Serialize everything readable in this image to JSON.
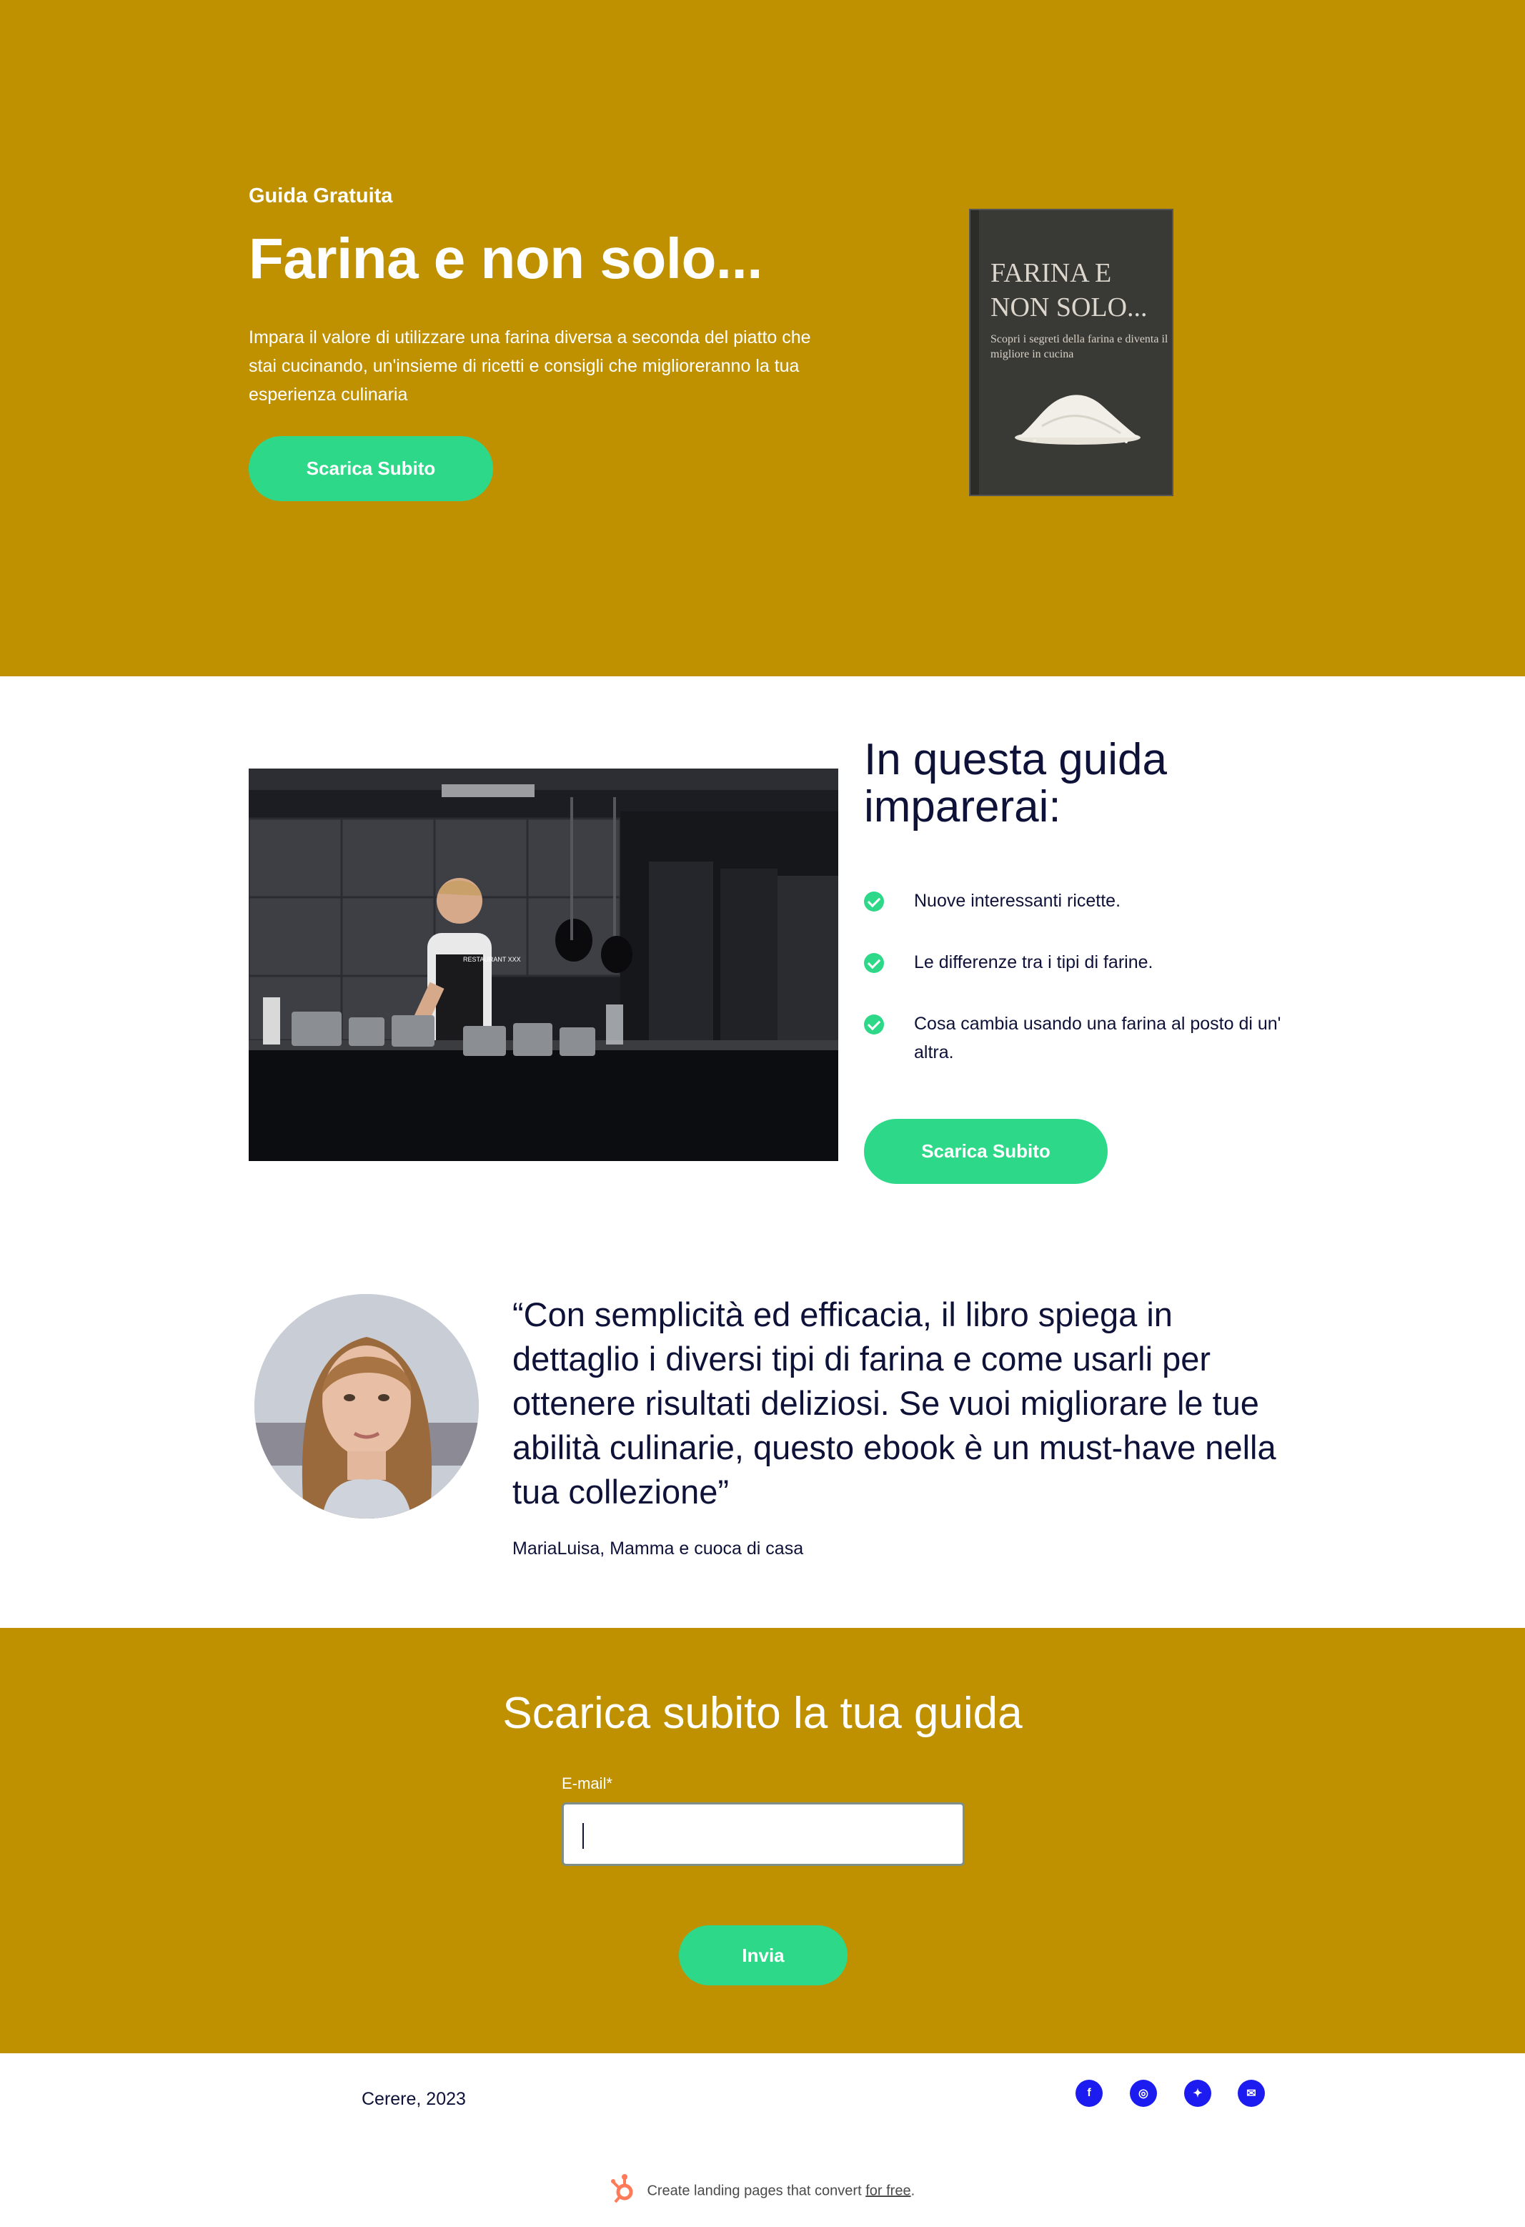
{
  "hero": {
    "eyebrow": "Guida Gratuita",
    "title": "Farina e non solo...",
    "description": "Impara il valore di utilizzare una farina diversa a seconda del piatto che stai cucinando, un'insieme di ricetti e consigli che miglioreranno la tua esperienza culinaria",
    "cta_label": "Scarica Subito",
    "background_color": "#bf9100",
    "book": {
      "title": "FARINA E NON SOLO...",
      "subtitle": "Scopri i segreti della farina e diventa il migliore in cucina"
    }
  },
  "guide": {
    "title": "In questa guida imparerai:",
    "items": [
      {
        "text": "Nuove interessanti ricette."
      },
      {
        "text": "Le differenze tra i tipi di farine."
      },
      {
        "text": "Cosa cambia usando una farina al posto di un' altra."
      }
    ],
    "cta_label": "Scarica Subito",
    "kitchen_sign": "RESTAURANT XXX"
  },
  "testimonial": {
    "quote": "“Con semplicità ed efficacia, il libro spiega in dettaglio i diversi tipi di farina e come usarli per ottenere risultati deliziosi. Se vuoi migliorare le tue abilità culinarie, questo ebook è un must-have nella tua collezione”",
    "author": "MariaLuisa, Mamma e cuoca di casa"
  },
  "form": {
    "title": "Scarica subito la tua guida",
    "email_label": "E-mail*",
    "email_value": "",
    "submit_label": "Invia"
  },
  "footer": {
    "copyright": "Cerere, 2023",
    "social": [
      {
        "icon": "facebook-icon",
        "glyph": "f"
      },
      {
        "icon": "instagram-icon",
        "glyph": "◎"
      },
      {
        "icon": "twitter-icon",
        "glyph": "✦"
      },
      {
        "icon": "email-icon",
        "glyph": "✉"
      }
    ],
    "hubspot_text": "Create landing pages that convert",
    "hubspot_link": "for free",
    "hubspot_suffix": "."
  },
  "colors": {
    "accent_green": "#2ed889",
    "gold": "#bf9100",
    "navy_text": "#0f1238",
    "social_blue": "#1c1cf0"
  }
}
